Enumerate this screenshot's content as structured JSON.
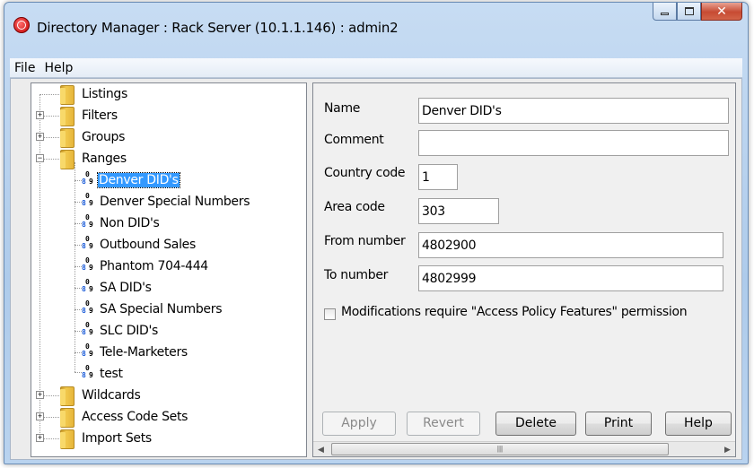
{
  "window": {
    "title": "Directory Manager : Rack Server (10.1.1.146) : admin2",
    "close_glyph": "✕"
  },
  "menu": {
    "file": "File",
    "help": "Help"
  },
  "tree": {
    "expander_plus": "+",
    "expander_minus": "−",
    "folders": {
      "listings": "Listings",
      "filters": "Filters",
      "groups": "Groups",
      "ranges": "Ranges",
      "wildcards": "Wildcards",
      "access_code_sets": "Access Code Sets",
      "import_sets": "Import Sets"
    },
    "ranges": [
      "Denver DID's",
      "Denver Special Numbers",
      "Non DID's",
      "Outbound Sales",
      "Phantom 704-444",
      "SA DID's",
      "SA Special Numbers",
      "SLC DID's",
      "Tele-Marketers",
      "test"
    ],
    "range_icon_digits": {
      "top": "0",
      "left": "8",
      "right": "9"
    }
  },
  "form": {
    "name_label": "Name",
    "name_value": "Denver DID's",
    "comment_label": "Comment",
    "comment_value": "",
    "country_code_label": "Country code",
    "country_code_value": "1",
    "area_code_label": "Area code",
    "area_code_value": "303",
    "from_number_label": "From number",
    "from_number_value": "4802900",
    "to_number_label": "To number",
    "to_number_value": "4802999",
    "permission_label": "Modifications require \"Access Policy Features\" permission",
    "permission_checked": false
  },
  "buttons": {
    "apply": "Apply",
    "revert": "Revert",
    "delete": "Delete",
    "print": "Print",
    "help": "Help"
  },
  "scrollbar": {
    "left_arrow": "◀",
    "right_arrow": "▶",
    "grip": "|||"
  }
}
